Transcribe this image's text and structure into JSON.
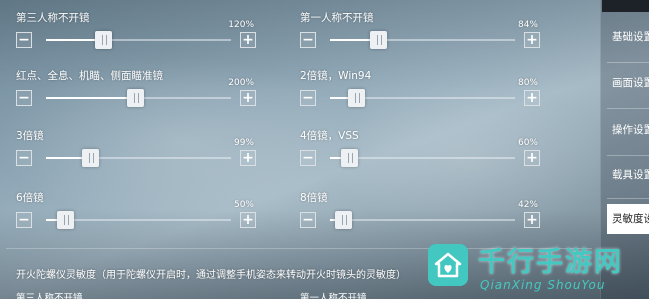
{
  "sensitivity": [
    {
      "label": "第三人称不开镜",
      "value": "120%",
      "level_percent": 31
    },
    {
      "label": "第一人称不开镜",
      "value": "84%",
      "level_percent": 26
    },
    {
      "label": "红点、全息、机瞄、侧面瞄准镜",
      "value": "200%",
      "level_percent": 48
    },
    {
      "label": "2倍镜，Win94",
      "value": "80%",
      "level_percent": 14
    },
    {
      "label": "3倍镜",
      "value": "99%",
      "level_percent": 24
    },
    {
      "label": "4倍镜，VSS",
      "value": "60%",
      "level_percent": 10
    },
    {
      "label": "6倍镜",
      "value": "50%",
      "level_percent": 10
    },
    {
      "label": "8倍镜",
      "value": "42%",
      "level_percent": 7
    }
  ],
  "controls": {
    "minus": "−",
    "plus": "+"
  },
  "gyro": {
    "title": "开火陀螺仪灵敏度（用于陀螺仪开启时，通过调整手机姿态来转动开火时镜头的灵敏度）",
    "col1_label": "第三人称不开镜",
    "col2_label": "第一人称不开镜"
  },
  "tabs": [
    {
      "label": "基础设置",
      "active": false
    },
    {
      "label": "画面设置",
      "active": false
    },
    {
      "label": "操作设置",
      "active": false
    },
    {
      "label": "载具设置",
      "active": false
    },
    {
      "label": "灵敏度设置",
      "active": true
    }
  ],
  "watermark": {
    "title": "千行手游网",
    "subtitle": "QianXing ShouYou"
  },
  "colors": {
    "accent": "#44c9c2",
    "active_tab_bg": "#ffffff"
  }
}
